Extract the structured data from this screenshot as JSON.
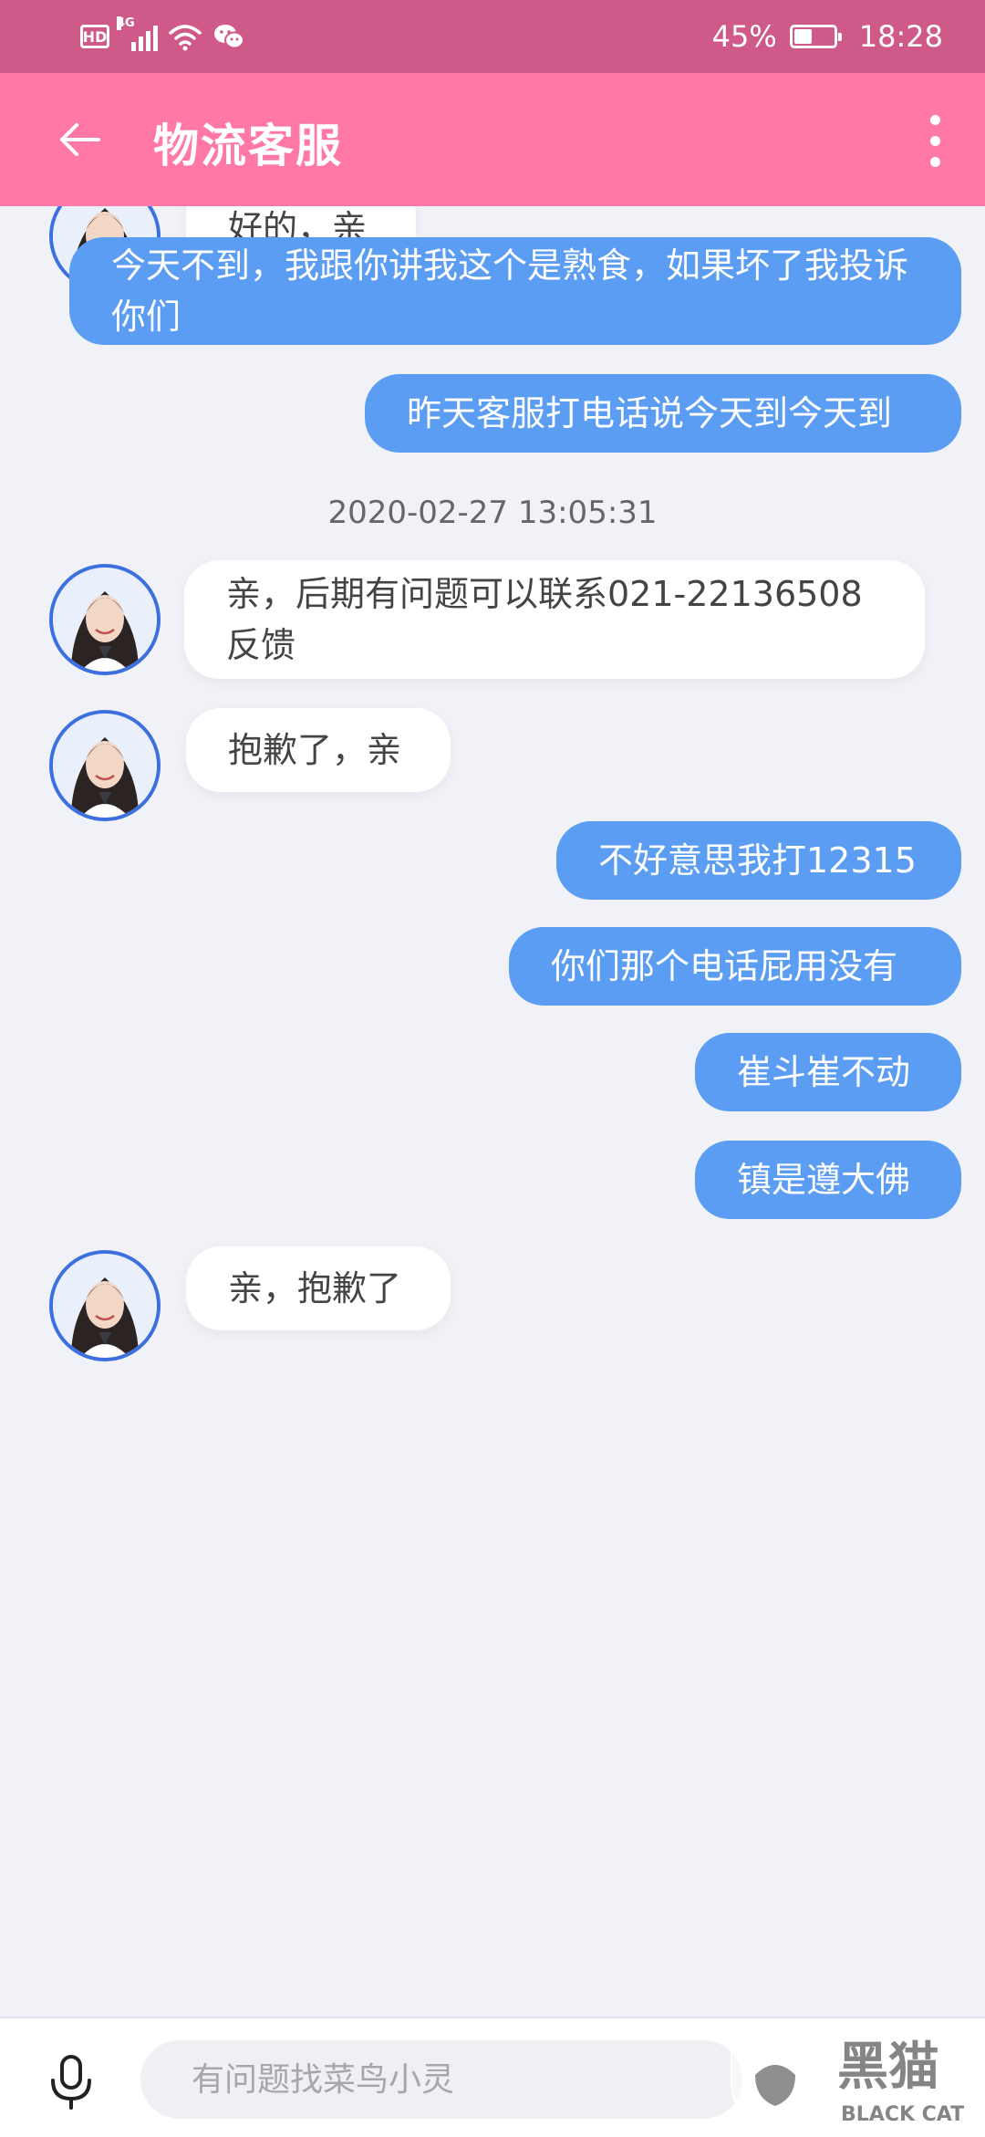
{
  "status_bar": {
    "hd": "HD",
    "network": "4G",
    "battery_percent_text": "45%",
    "battery_level": 0.45,
    "time": "18:28",
    "icons": [
      "hd-icon",
      "signal-icon",
      "wifi-icon",
      "wechat-icon",
      "battery-icon"
    ]
  },
  "header": {
    "title": "物流客服",
    "back_icon": "arrow-left-icon",
    "more_icon": "more-vertical-icon"
  },
  "messages": [
    {
      "side": "in",
      "text": "好的，亲"
    },
    {
      "side": "out",
      "text": "今天不到，我跟你讲我这个是熟食，如果坏了我投诉你们"
    },
    {
      "side": "out",
      "text": "昨天客服打电话说今天到今天到"
    },
    {
      "type": "timestamp",
      "text": "2020-02-27 13:05:31"
    },
    {
      "side": "in",
      "text": "亲，后期有问题可以联系021-22136508反馈"
    },
    {
      "side": "in",
      "text": "抱歉了，亲"
    },
    {
      "side": "out",
      "text": "不好意思我打12315"
    },
    {
      "side": "out",
      "text": "你们那个电话屁用没有"
    },
    {
      "side": "out",
      "text": "崔斗崔不动"
    },
    {
      "side": "out",
      "text": "镇是遵大佛"
    },
    {
      "side": "in",
      "text": "亲，抱歉了"
    }
  ],
  "input_bar": {
    "mic_icon": "microphone-icon",
    "placeholder": "有问题找菜鸟小灵",
    "value": ""
  },
  "watermark": {
    "logo_text": "黑猫",
    "sub_text": "BLACK CAT"
  },
  "colors": {
    "status_bar": "#cf5a89",
    "header": "#ff78a8",
    "background": "#f1f2f7",
    "outgoing_bubble": "#5b9df2",
    "incoming_bubble": "#ffffff",
    "avatar_border": "#3c6fe0"
  }
}
